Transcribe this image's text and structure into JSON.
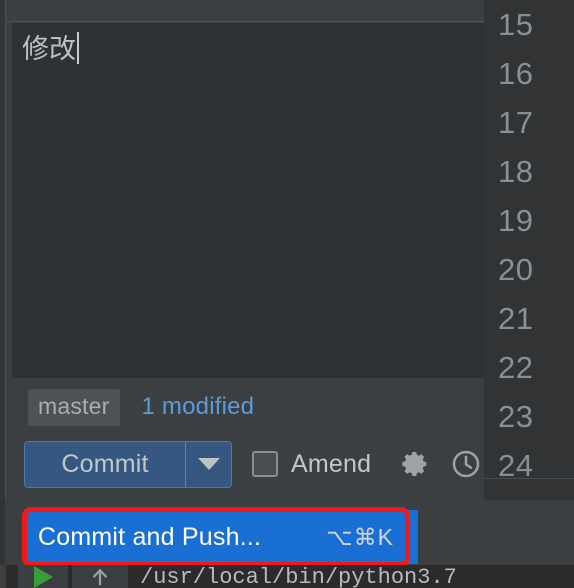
{
  "commit_panel": {
    "message_value": "修改",
    "branch": "master",
    "changes_summary": "1 modified",
    "commit_button_label": "Commit",
    "commit_dropdown_icon": "chevron-down-icon",
    "amend_label": "Amend",
    "amend_checked": false,
    "settings_icon": "gear-icon",
    "history_icon": "clock-icon"
  },
  "popup_menu": {
    "items": [
      {
        "label": "Commit and Push...",
        "shortcut": "⌥⌘K",
        "highlighted": true
      }
    ],
    "highlight_color": "#1a6fd4",
    "annotation_color": "#ef1b18"
  },
  "editor_gutter": {
    "line_numbers": [
      "15",
      "16",
      "17",
      "18",
      "19",
      "20",
      "21",
      "22",
      "23",
      "24"
    ]
  },
  "bottom_toolbar": {
    "run_icon": "play-icon",
    "scroll_up_icon": "arrow-up-icon",
    "console_text": "/usr/local/bin/python3.7"
  },
  "colors": {
    "panel_bg": "#3c3f41",
    "editor_bg": "#2f3234",
    "gutter_bg": "#313335",
    "commit_button": "#365880",
    "link_blue": "#5b9bd8",
    "highlight_blue": "#1a6fd4",
    "annotation_red": "#ef1b18",
    "run_green": "#389e3c"
  }
}
